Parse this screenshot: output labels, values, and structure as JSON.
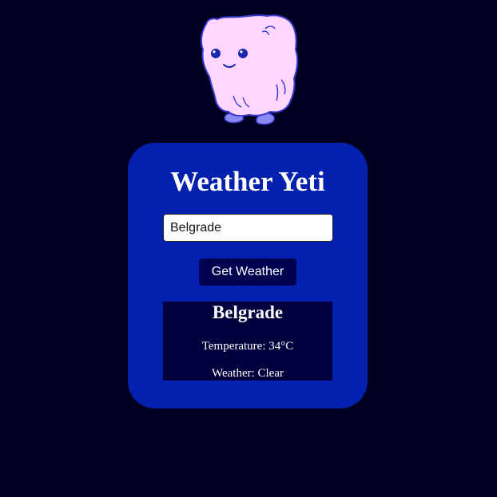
{
  "app": {
    "title": "Weather Yeti",
    "mascot_icon": "yeti-mascot-icon"
  },
  "search": {
    "value": "Belgrade",
    "button_label": "Get Weather"
  },
  "result": {
    "city": "Belgrade",
    "temperature": "Temperature: 34°C",
    "weather": "Weather: Clear"
  },
  "colors": {
    "page_background": "#000020",
    "card_background": "#0420ae",
    "button_background": "#000050",
    "result_background": "#00003c",
    "yeti_fur": "#ffd6ff",
    "yeti_outline": "#3a3ad0"
  }
}
